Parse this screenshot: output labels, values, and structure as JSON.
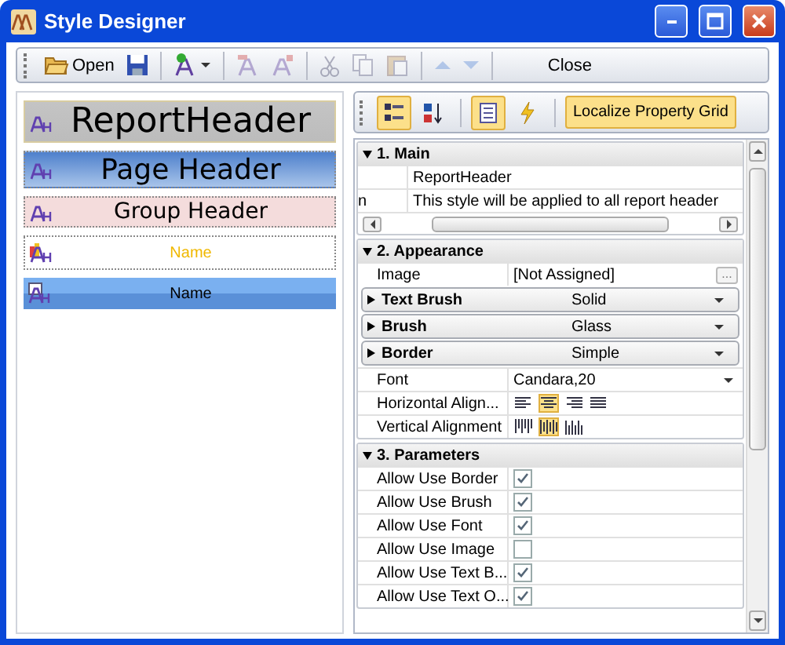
{
  "window": {
    "title": "Style Designer"
  },
  "toolbar": [
    {
      "kind": "button",
      "label": "Open",
      "disabled": false
    },
    {
      "kind": "button",
      "disabled": false
    },
    {
      "kind": "separator"
    },
    {
      "kind": "dropdown",
      "disabled": false
    },
    {
      "kind": "separator"
    },
    {
      "kind": "button",
      "disabled": true
    },
    {
      "kind": "button",
      "disabled": true
    },
    {
      "kind": "separator"
    },
    {
      "kind": "button",
      "disabled": true
    },
    {
      "kind": "button",
      "disabled": true
    },
    {
      "kind": "button",
      "disabled": true
    },
    {
      "kind": "separator"
    },
    {
      "kind": "button",
      "disabled": true
    },
    {
      "kind": "button",
      "disabled": true
    },
    {
      "kind": "separator"
    },
    {
      "kind": "text",
      "label": "Close"
    }
  ],
  "styles": [
    {
      "name": "ReportHeader",
      "kind": "gray",
      "selected": true
    },
    {
      "name": "Page Header",
      "kind": "blue",
      "selected": false
    },
    {
      "name": "Group Header",
      "kind": "pink",
      "selected": false
    },
    {
      "name": "Name",
      "kind": "chart",
      "selected": false
    },
    {
      "name": "Name",
      "kind": "lightblue",
      "selected": false
    }
  ],
  "property_grid": {
    "toolbar": [
      {
        "kind": "icon",
        "selected": true
      },
      {
        "kind": "icon",
        "selected": false
      },
      {
        "kind": "separator"
      },
      {
        "kind": "icon",
        "selected": true
      },
      {
        "kind": "icon",
        "selected": false
      },
      {
        "kind": "separator"
      },
      {
        "kind": "text",
        "label": "Localize Property Grid",
        "selected": true
      }
    ],
    "sections": [
      {
        "title": "1. Main",
        "expanded": true,
        "rows": [
          {
            "kind": "text",
            "value": "ReportHeader"
          },
          {
            "kind": "text",
            "name": "n",
            "value": "This style will be applied to all report header"
          },
          {
            "kind": "hscroll"
          }
        ]
      },
      {
        "title": "2. Appearance",
        "expanded": true,
        "rows": [
          {
            "kind": "picker",
            "name": "Image",
            "value": "[Not Assigned]",
            "button": "..."
          },
          {
            "kind": "group",
            "name": "Text Brush",
            "value": "Solid",
            "expanded": false
          },
          {
            "kind": "group",
            "name": "Brush",
            "value": "Glass",
            "expanded": false
          },
          {
            "kind": "group",
            "name": "Border",
            "value": "Simple",
            "expanded": false
          },
          {
            "kind": "dropdown",
            "name": "Font",
            "value": "Candara,20"
          },
          {
            "kind": "halign",
            "name": "Horizontal Align...",
            "options": [
              {
                "selected": false
              },
              {
                "selected": true
              },
              {
                "selected": false
              },
              {
                "selected": false
              }
            ]
          },
          {
            "kind": "valign",
            "name": "Vertical Alignment",
            "options": [
              {
                "selected": false
              },
              {
                "selected": true
              },
              {
                "selected": false
              }
            ]
          }
        ]
      },
      {
        "title": "3. Parameters",
        "expanded": true,
        "rows": [
          {
            "kind": "check",
            "name": "Allow Use Border",
            "checked": true
          },
          {
            "kind": "check",
            "name": "Allow Use Brush",
            "checked": true
          },
          {
            "kind": "check",
            "name": "Allow Use Font",
            "checked": true
          },
          {
            "kind": "check",
            "name": "Allow Use Image",
            "checked": false
          },
          {
            "kind": "check",
            "name": "Allow Use Text B...",
            "checked": true
          },
          {
            "kind": "check",
            "name": "Allow Use Text O...",
            "checked": true
          }
        ]
      }
    ]
  }
}
